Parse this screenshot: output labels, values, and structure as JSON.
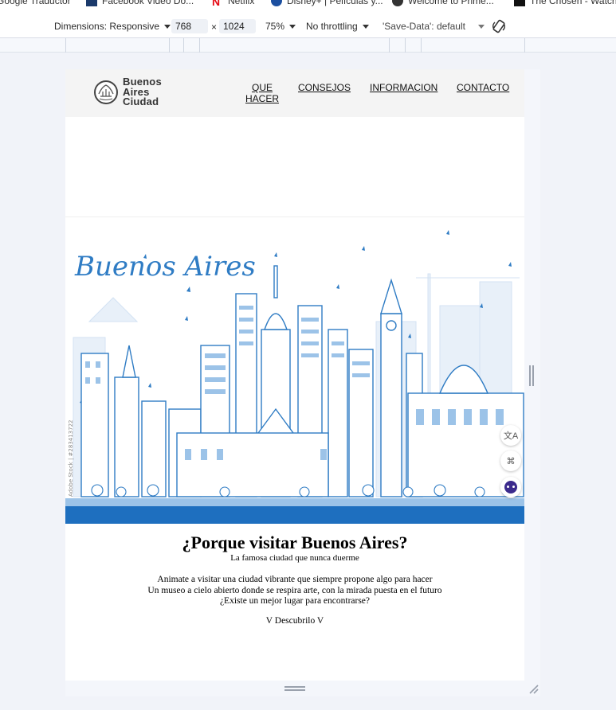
{
  "bookmarks": [
    {
      "label": "Google Traductor",
      "icon": "translate-icon"
    },
    {
      "label": "Facebook Video Do...",
      "icon": "facebook-icon"
    },
    {
      "label": "Netflix",
      "icon": "netflix-icon"
    },
    {
      "label": "Disney+ | Películas y...",
      "icon": "disney-icon"
    },
    {
      "label": "Welcome to Prime...",
      "icon": "prime-icon"
    },
    {
      "label": "The Chosen - Watch...",
      "icon": "chosen-icon"
    }
  ],
  "devtools": {
    "dimensions_label": "Dimensions: Responsive",
    "width": "768",
    "times": "×",
    "height": "1024",
    "zoom": "75%",
    "throttling": "No throttling",
    "save_data": "'Save-Data': default"
  },
  "site": {
    "logo_line1": "Buenos",
    "logo_line2": "Aires",
    "logo_line3": "Ciudad",
    "nav": {
      "que_hacer_1": "QUE",
      "que_hacer_2": "HACER",
      "consejos": "CONSEJOS",
      "informacion": "INFORMACION",
      "contacto": "CONTACTO"
    },
    "hero_title": "Buenos Aires",
    "hero_watermark": "Adobe Stock | #283413722",
    "heading": "¿Porque visitar Buenos Aires?",
    "subheading": "La famosa ciudad que nunca duerme",
    "paragraph_1": "Animate a visitar una ciudad vibrante que siempre propone algo para hacer",
    "paragraph_2": "Un museo a cielo abierto donde se respira arte, con la mirada puesta en el futuro",
    "paragraph_3": "¿Existe un mejor lugar para encontrarse?",
    "cta": "V Descubrilo V"
  },
  "colors": {
    "skyline_blue": "#2f7cc4",
    "skyline_light": "#9cc3e8",
    "ground_blue": "#1e6fbf"
  }
}
